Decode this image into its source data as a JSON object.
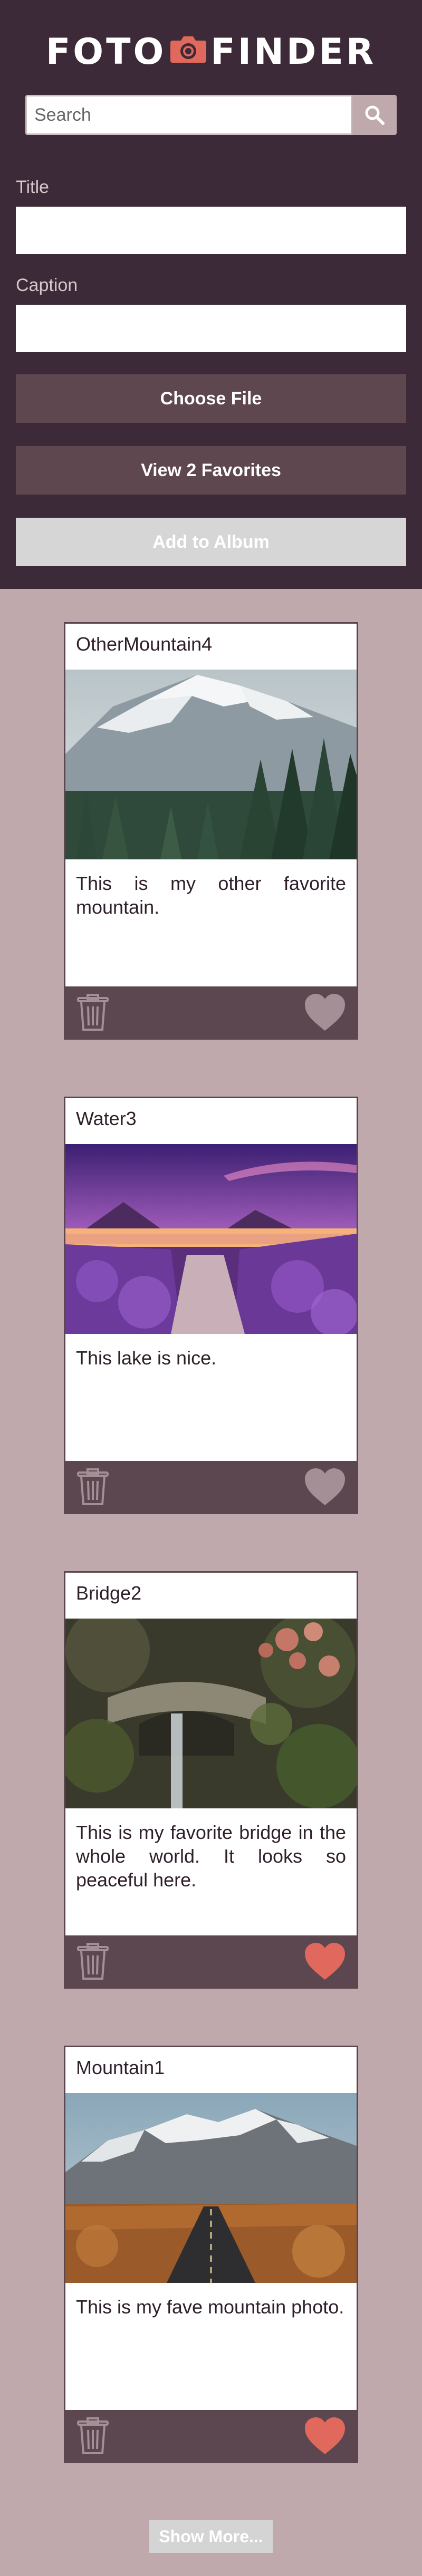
{
  "header": {
    "logo_left": "FOTO",
    "logo_right": "FINDER",
    "search_placeholder": "Search",
    "title_label": "Title",
    "caption_label": "Caption",
    "choose_file_label": "Choose File",
    "view_favorites_label": "View 2 Favorites",
    "add_to_album_label": "Add to Album"
  },
  "cards": [
    {
      "title": "OtherMountain4",
      "caption": "This is my other favorite mountain.",
      "favorited": false
    },
    {
      "title": "Water3",
      "caption": "This lake is nice.",
      "favorited": false
    },
    {
      "title": "Bridge2",
      "caption": "This is my favorite bridge in the whole world. It looks so peaceful here.",
      "favorited": true
    },
    {
      "title": "Mountain1",
      "caption": "This is my fave mountain photo.",
      "favorited": true
    }
  ],
  "show_more_label": "Show More...",
  "colors": {
    "header_bg": "#3c2a38",
    "page_bg": "#bfa9ac",
    "card_footer": "#5c4750",
    "heart_active": "#e0685c",
    "heart_inactive": "#a58f96",
    "camera_icon": "#e0685c"
  }
}
